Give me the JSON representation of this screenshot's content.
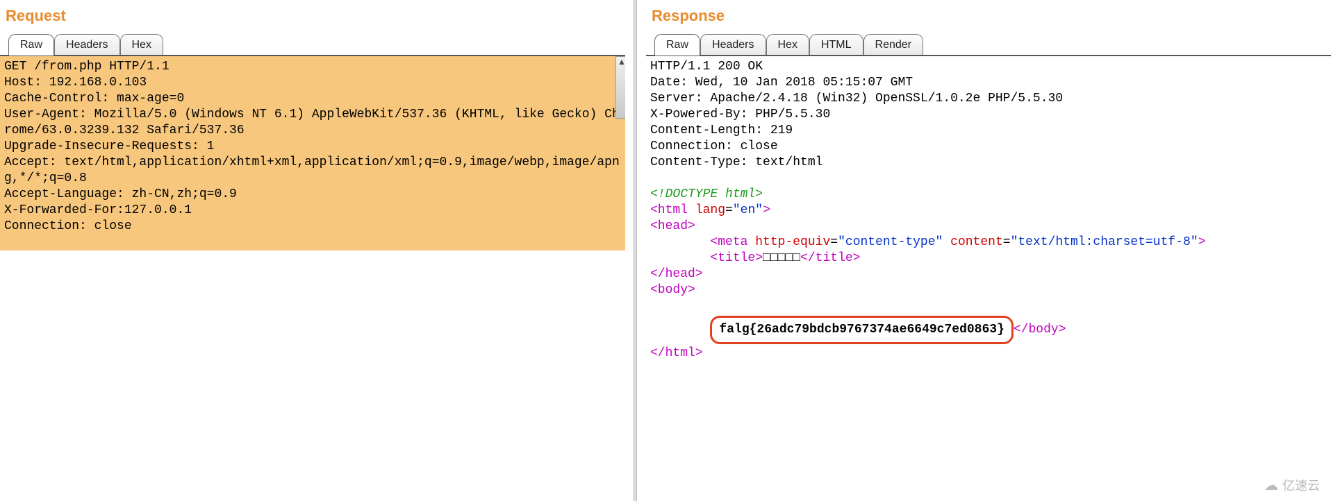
{
  "request": {
    "title": "Request",
    "tabs": {
      "raw": "Raw",
      "headers": "Headers",
      "hex": "Hex"
    },
    "active_tab": "Raw",
    "body_lines": [
      "GET /from.php HTTP/1.1",
      "Host: 192.168.0.103",
      "Cache-Control: max-age=0",
      "User-Agent: Mozilla/5.0 (Windows NT 6.1) AppleWebKit/537.36 (KHTML, like Gecko) Chrome/63.0.3239.132 Safari/537.36",
      "Upgrade-Insecure-Requests: 1",
      "Accept: text/html,application/xhtml+xml,application/xml;q=0.9,image/webp,image/apng,*/*;q=0.8",
      "Accept-Language: zh-CN,zh;q=0.9",
      "X-Forwarded-For:127.0.0.1",
      "Connection: close"
    ]
  },
  "response": {
    "title": "Response",
    "tabs": {
      "raw": "Raw",
      "headers": "Headers",
      "hex": "Hex",
      "html": "HTML",
      "render": "Render"
    },
    "active_tab": "Raw",
    "header_lines": [
      "HTTP/1.1 200 OK",
      "Date: Wed, 10 Jan 2018 05:15:07 GMT",
      "Server: Apache/2.4.18 (Win32) OpenSSL/1.0.2e PHP/5.5.30",
      "X-Powered-By: PHP/5.5.30",
      "Content-Length: 219",
      "Connection: close",
      "Content-Type: text/html"
    ],
    "html_markup": {
      "doctype": "<!DOCTYPE html>",
      "html_open": "<html",
      "html_attr_name": "lang",
      "html_attr_val": "\"en\"",
      "html_close": ">",
      "head_open": "<head>",
      "meta_open": "<meta",
      "meta_attr1_name": "http-equiv",
      "meta_attr1_val": "\"content-type\"",
      "meta_attr2_name": "content",
      "meta_attr2_val": "\"text/html:charset=utf-8\"",
      "meta_close": ">",
      "title_open": "<title>",
      "title_text": "□□□□□",
      "title_close": "</title>",
      "head_close": "</head>",
      "body_open": "<body>",
      "flag_text": "falg{26adc79bdcb9767374ae6649c7ed0863}",
      "body_close": "</body>",
      "html_end": "</html>"
    }
  },
  "watermark": "亿速云"
}
